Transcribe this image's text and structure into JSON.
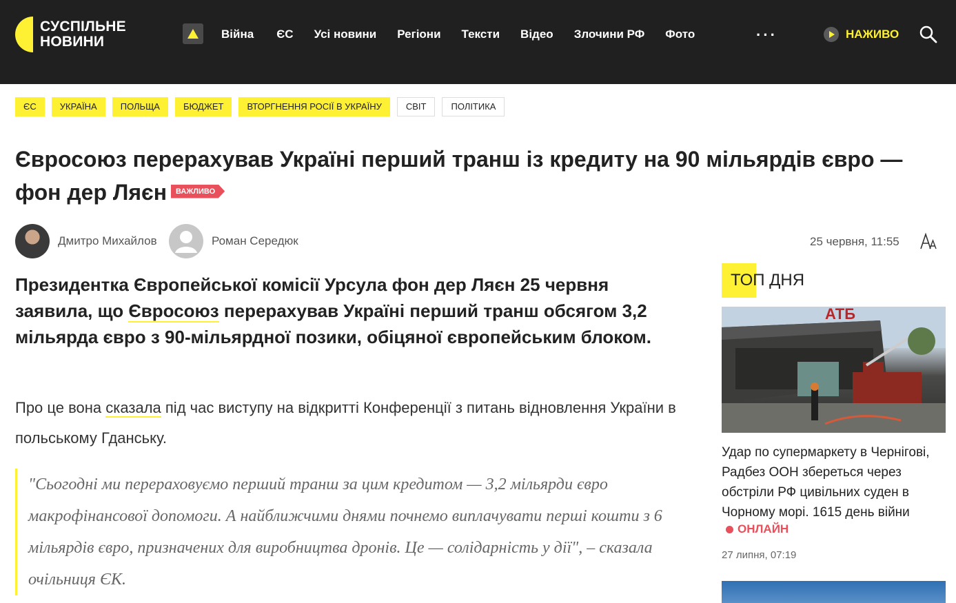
{
  "header": {
    "logo_line1": "Суспільне",
    "logo_line2": "Новини",
    "nav": [
      "Війна",
      "ЄС",
      "Усі новини",
      "Регіони",
      "Тексти",
      "Відео",
      "Злочини РФ",
      "Фото"
    ],
    "more": "···",
    "live_label": "НАЖИВО"
  },
  "tags": [
    {
      "label": "ЄС",
      "style": "yellow"
    },
    {
      "label": "Україна",
      "style": "yellow"
    },
    {
      "label": "Польща",
      "style": "yellow"
    },
    {
      "label": "Бюджет",
      "style": "yellow"
    },
    {
      "label": "Вторгнення Росії в Україну",
      "style": "yellow"
    },
    {
      "label": "Світ",
      "style": "plain"
    },
    {
      "label": "Політика",
      "style": "plain"
    }
  ],
  "article": {
    "title": "Євросоюз перерахував Україні перший транш із кредиту на 90 мільярдів євро — фон дер Ляєн",
    "badge": "Важливо",
    "authors": [
      "Дмитро Михайлов",
      "Роман Середюк"
    ],
    "date": "25 червня, 11:55",
    "lead_before": "Президентка Європейської комісії Урсула фон дер Ляєн 25 червня заявила, що ",
    "lead_link": "Євросоюз",
    "lead_after": " перерахував Україні перший транш обсягом 3,2 мільярда євро з 90-мільярдної позики, обіцяної європейським блоком.",
    "para_before": "Про це вона ",
    "para_link": "сказала",
    "para_after": " під час виступу на відкритті Конференції з питань відновлення України в польському Гданську.",
    "quote": "\"Сьогодні ми перераховуємо перший транш за цим кредитом — 3,2 мільярди євро макрофінансової допомоги. А найближчими днями почнемо виплачувати перші кошти з 6 мільярдів євро, призначених для виробництва дронів. Це — солідарність у дії\", – сказала очільниця ЄК."
  },
  "sidebar": {
    "heading_part1": "ТОП",
    "heading_part2": " ДНЯ",
    "news": {
      "image_sign": "АТБ",
      "title": "Удар по супермаркету в Чернігові, Радбез ООН збереться через обстріли РФ цивільних суден в Чорному морі. 1615 день війни",
      "online": "ОНЛАЙН",
      "date": "27 липня, 07:19"
    }
  }
}
